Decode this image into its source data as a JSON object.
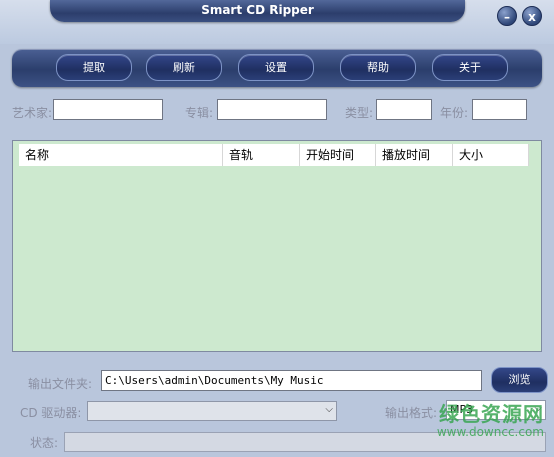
{
  "app": {
    "title": "Smart CD Ripper"
  },
  "window_controls": {
    "minimize": "–",
    "close": "x"
  },
  "toolbar": {
    "buttons": [
      "提取",
      "刷新",
      "设置",
      "帮助",
      "关于"
    ]
  },
  "metadata": {
    "artist_label": "艺术家:",
    "album_label": "专辑:",
    "genre_label": "类型:",
    "year_label": "年份:",
    "artist_value": "",
    "album_value": "",
    "genre_value": "",
    "year_value": ""
  },
  "tracks_table": {
    "columns": [
      "名称",
      "音轨",
      "开始时间",
      "播放时间",
      "大小"
    ],
    "rows": []
  },
  "output": {
    "folder_label": "输出文件夹:",
    "folder_value": "C:\\Users\\admin\\Documents\\My Music",
    "browse_label": "浏览",
    "drive_label": "CD 驱动器:",
    "drive_value": "",
    "format_label": "输出格式:",
    "format_value": "MP3"
  },
  "status": {
    "label": "状态:",
    "value": ""
  },
  "watermark": {
    "main": "绿色资源网",
    "url": "www.downcc.com"
  },
  "colors": {
    "background": "#b9c6dc",
    "toolbar": "#2b3e6c",
    "table_body": "#cde9cf",
    "label_gray": "#8a8fa2",
    "watermark_green": "#3aa653"
  }
}
